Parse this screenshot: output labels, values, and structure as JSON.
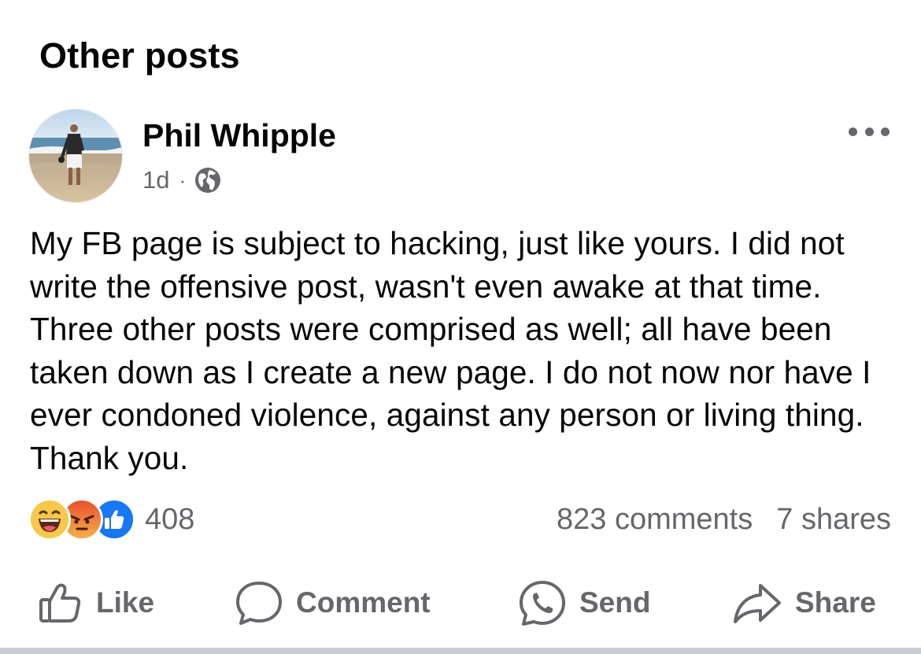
{
  "section": {
    "title": "Other posts"
  },
  "post": {
    "author": "Phil Whipple",
    "timestamp": "1d",
    "separator": "·",
    "privacy_icon": "globe-icon",
    "more_icon": "more-horizontal-icon",
    "body": "My FB page is subject to hacking, just like yours. I did not write the offensive post, wasn't even awake at that time. Three other posts were comprised as well; all have been taken down as I create a new page. I do not now nor have I ever condoned violence, against any person or living thing. Thank you."
  },
  "reactions": {
    "icons": [
      "haha-icon",
      "angry-icon",
      "like-reaction-icon"
    ],
    "count": "408",
    "comments": "823 comments",
    "shares": "7 shares"
  },
  "actions": {
    "like_label": "Like",
    "comment_label": "Comment",
    "send_label": "Send",
    "share_label": "Share"
  },
  "colors": {
    "primary_text": "#050505",
    "secondary_text": "#65676b",
    "like_blue": "#1877f2",
    "angry_orange": "#f0703a",
    "haha_yellow": "#f7c84a",
    "divider": "#c9ccd1"
  }
}
